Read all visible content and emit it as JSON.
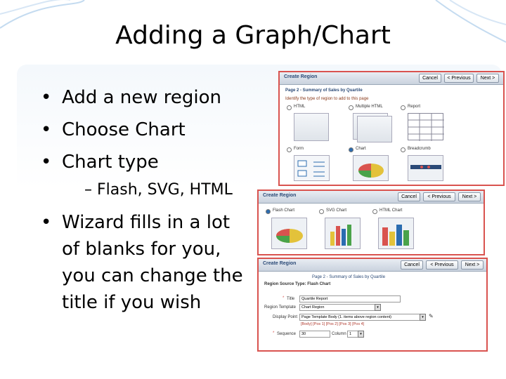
{
  "slide": {
    "title": "Adding a Graph/Chart"
  },
  "bullets": {
    "items": [
      "Add a new region",
      "Choose Chart",
      "Chart type"
    ],
    "sub_item": "– Flash, SVG, HTML",
    "last_item_lines": [
      "Wizard fills in a lot",
      "of blanks for you,",
      "you can change the",
      "title if you wish"
    ],
    "bullet_glyph": "•"
  },
  "screenshot1": {
    "header": "Create Region",
    "buttons": {
      "cancel": "Cancel",
      "previous": "< Previous",
      "next": "Next >"
    },
    "subtitle": "Page 2 - Summary of Sales by Quartile",
    "prompt": "Identify the type of region to add to this page",
    "types": [
      "HTML",
      "Multiple HTML",
      "Report",
      "Form",
      "Chart",
      "Breadcrumb"
    ],
    "selected": "Chart"
  },
  "screenshot2": {
    "header": "Create Region",
    "buttons": {
      "cancel": "Cancel",
      "previous": "< Previous",
      "next": "Next >"
    },
    "chart_types": [
      "Flash Chart",
      "SVG Chart",
      "HTML Chart"
    ],
    "selected": "Flash Chart"
  },
  "screenshot3": {
    "header": "Create Region",
    "buttons": {
      "cancel": "Cancel",
      "previous": "< Previous",
      "next": "Next >"
    },
    "subtitle": "Page 2 - Summary of Sales by Quartile",
    "region_source_type": "Region Source Type: Flash Chart",
    "fields": {
      "title_label": "Title",
      "title_value": "Quartile Report",
      "template_label": "Region Template",
      "template_value": "Chart Region",
      "display_label": "Display Point",
      "display_value": "Page Template Body (1. items above region content)",
      "display_links": "[Body] [Pos 1] [Pos 2] [Pos 3] [Pos 4]",
      "sequence_label": "Sequence",
      "sequence_value": "30",
      "column_label": "Column",
      "column_value": "1"
    }
  },
  "colors": {
    "accent_border": "#d9534f",
    "theme_blue": "#2b6cb0",
    "header_text": "#2b4a77"
  }
}
